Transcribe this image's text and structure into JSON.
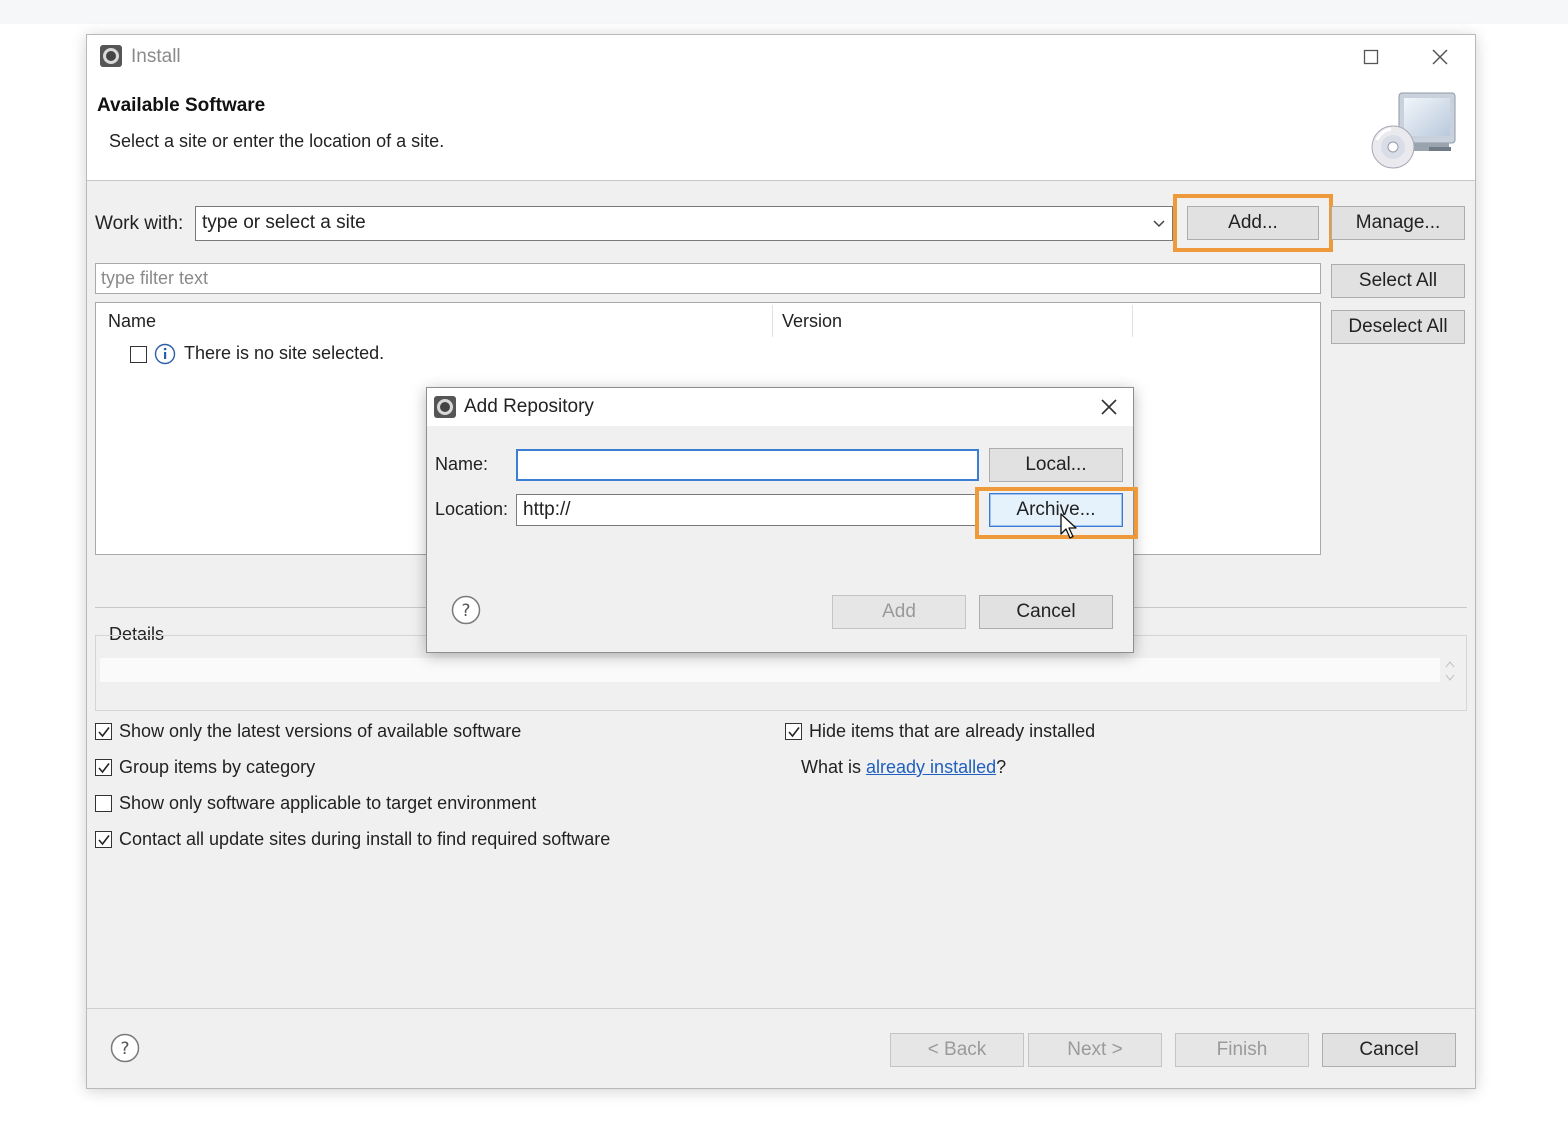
{
  "window": {
    "title": "Install",
    "header_title": "Available Software",
    "header_description": "Select a site or enter the location of a site."
  },
  "work_with": {
    "label": "Work with:",
    "value": "type or select a site",
    "add_button": "Add...",
    "manage_button": "Manage..."
  },
  "filter": {
    "placeholder": "type filter text"
  },
  "side_buttons": {
    "select_all": "Select All",
    "deselect_all": "Deselect All"
  },
  "tree": {
    "columns": [
      "Name",
      "Version"
    ],
    "empty_message": "There is no site selected."
  },
  "details": {
    "label": "Details"
  },
  "options": {
    "left": [
      {
        "label": "Show only the latest versions of available software",
        "checked": true
      },
      {
        "label": "Group items by category",
        "checked": true
      },
      {
        "label": "Show only software applicable to target environment",
        "checked": false
      },
      {
        "label": "Contact all update sites during install to find required software",
        "checked": true
      }
    ],
    "hide_installed": {
      "label": "Hide items that are already installed",
      "checked": true
    },
    "what_is_prefix": "What is ",
    "what_is_link": "already installed",
    "what_is_suffix": "?"
  },
  "footer": {
    "back": "< Back",
    "next": "Next >",
    "finish": "Finish",
    "cancel": "Cancel"
  },
  "dialog": {
    "title": "Add Repository",
    "name_label": "Name:",
    "name_value": "",
    "location_label": "Location:",
    "location_value": "http://",
    "local_button": "Local...",
    "archive_button": "Archive...",
    "add_button": "Add",
    "cancel_button": "Cancel"
  },
  "colors": {
    "highlight": "#ef9a3a",
    "link": "#1f5fbf",
    "focus": "#3b7fd4"
  }
}
